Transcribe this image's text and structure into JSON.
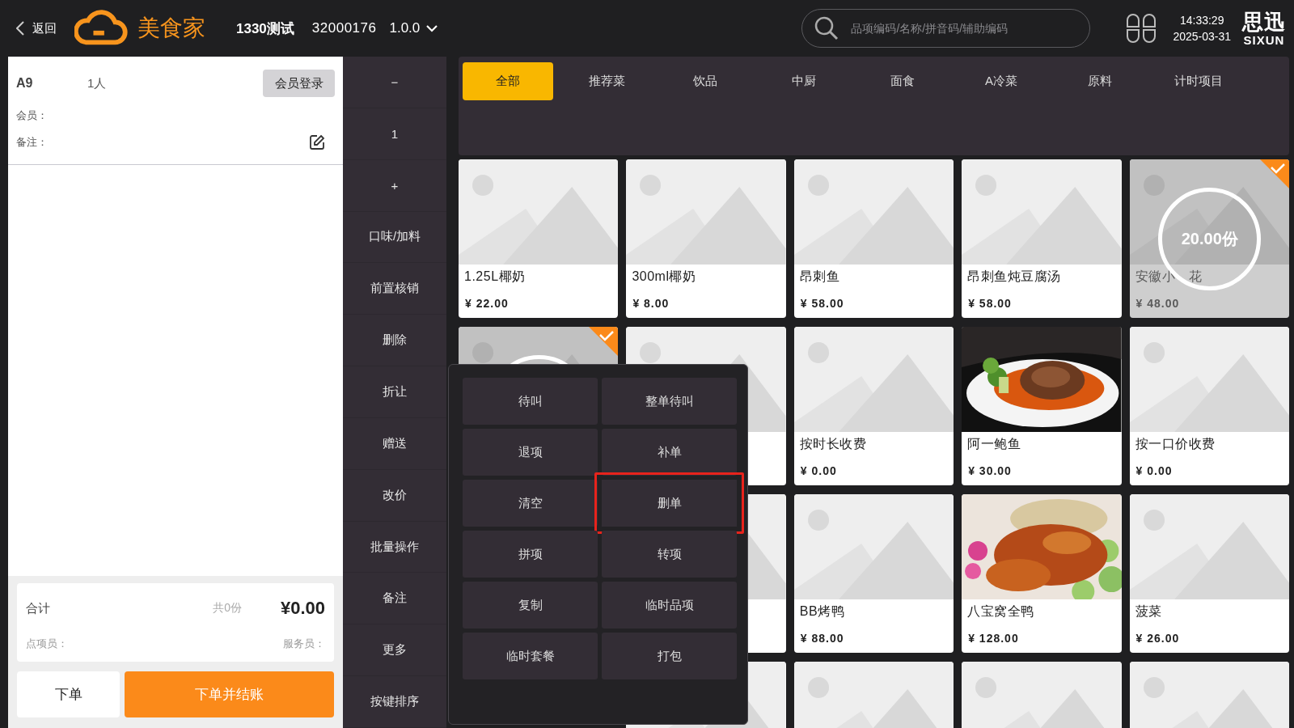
{
  "topbar": {
    "back_label": "返回",
    "brand": "美食家",
    "store": "1330测试",
    "store_id": "32000176",
    "version": "1.0.0",
    "search": {
      "placeholder": "品项编码/名称/拼音码/辅助编码"
    },
    "time": "14:33:29",
    "date": "2025-03-31",
    "vendor_logo": {
      "name": "思迅",
      "latin": "SIXUN"
    }
  },
  "order": {
    "table": "A9",
    "guests": "1人",
    "member_login": "会员登录",
    "member_label": "会员：",
    "note_label": "备注：",
    "total_label": "合计",
    "count": "共0份",
    "total": "¥0.00",
    "orderer_label": "点项员：",
    "waiter_label": "服务员：",
    "buttons": [
      {
        "label": "下单",
        "kind": "secondary"
      },
      {
        "label": "下单并结账",
        "kind": "primary"
      }
    ]
  },
  "actions": [
    "−",
    "1",
    "+",
    "口味/加料",
    "前置核销",
    "删除",
    "折让",
    "赠送",
    "改价",
    "批量操作",
    "备注",
    "更多",
    "按键排序"
  ],
  "categories": [
    {
      "label": "全部",
      "selected": true
    },
    {
      "label": "推荐菜",
      "selected": false
    },
    {
      "label": "饮品",
      "selected": false
    },
    {
      "label": "中厨",
      "selected": false
    },
    {
      "label": "面食",
      "selected": false
    },
    {
      "label": "A冷菜",
      "selected": false
    },
    {
      "label": "原料",
      "selected": false
    },
    {
      "label": "计时项目",
      "selected": false
    }
  ],
  "dishes": [
    {
      "kind": "placeholder",
      "name": "1.25L椰奶",
      "price": "¥ 22.00",
      "selected": false
    },
    {
      "kind": "placeholder",
      "name": "300ml椰奶",
      "price": "¥ 8.00",
      "selected": false
    },
    {
      "kind": "placeholder",
      "name": "昂刺鱼",
      "price": "¥ 58.00",
      "selected": false
    },
    {
      "kind": "placeholder",
      "name": "昂刺鱼炖豆腐汤",
      "price": "¥ 58.00",
      "selected": false
    },
    {
      "kind": "placeholder",
      "name_parts": [
        "安徽小",
        "花"
      ],
      "price": "¥ 48.00",
      "selected": true,
      "count": "20.00份"
    },
    {
      "kind": "placeholder",
      "selected": true
    },
    {
      "kind": "placeholder",
      "selected": false
    },
    {
      "kind": "placeholder",
      "name": "按时长收费",
      "price": "¥ 0.00",
      "selected": false
    },
    {
      "kind": "picture",
      "name": "阿一鲍鱼",
      "price": "¥ 30.00",
      "selected": false
    },
    {
      "kind": "placeholder",
      "name": "按一口价收费",
      "price": "¥ 0.00",
      "selected": false
    },
    {
      "kind": "covered"
    },
    {
      "kind": "placeholder",
      "selected": false
    },
    {
      "kind": "placeholder",
      "name": "BB烤鸭",
      "price": "¥ 88.00",
      "selected": false
    },
    {
      "kind": "picture",
      "name": "八宝窝全鸭",
      "price": "¥ 128.00",
      "selected": false
    },
    {
      "kind": "placeholder",
      "name": "菠菜",
      "price": "¥ 26.00",
      "selected": false
    },
    {
      "kind": "covered"
    },
    {
      "kind": "placeholder",
      "selected": false
    },
    {
      "kind": "placeholder",
      "selected": false
    },
    {
      "kind": "placeholder",
      "selected": false
    },
    {
      "kind": "placeholder",
      "selected": false
    }
  ],
  "more_menu": {
    "items": [
      {
        "label": "待叫",
        "selected": false
      },
      {
        "label": "整单待叫",
        "selected": false
      },
      {
        "label": "退项",
        "selected": false
      },
      {
        "label": "补单",
        "selected": false
      },
      {
        "label": "清空",
        "selected": false
      },
      {
        "label": "删单",
        "selected": true
      },
      {
        "label": "拼项",
        "selected": false
      },
      {
        "label": "转项",
        "selected": false
      },
      {
        "label": "复制",
        "selected": false
      },
      {
        "label": "临时品项",
        "selected": false
      },
      {
        "label": "临时套餐",
        "selected": false
      },
      {
        "label": "打包",
        "selected": false
      }
    ]
  }
}
